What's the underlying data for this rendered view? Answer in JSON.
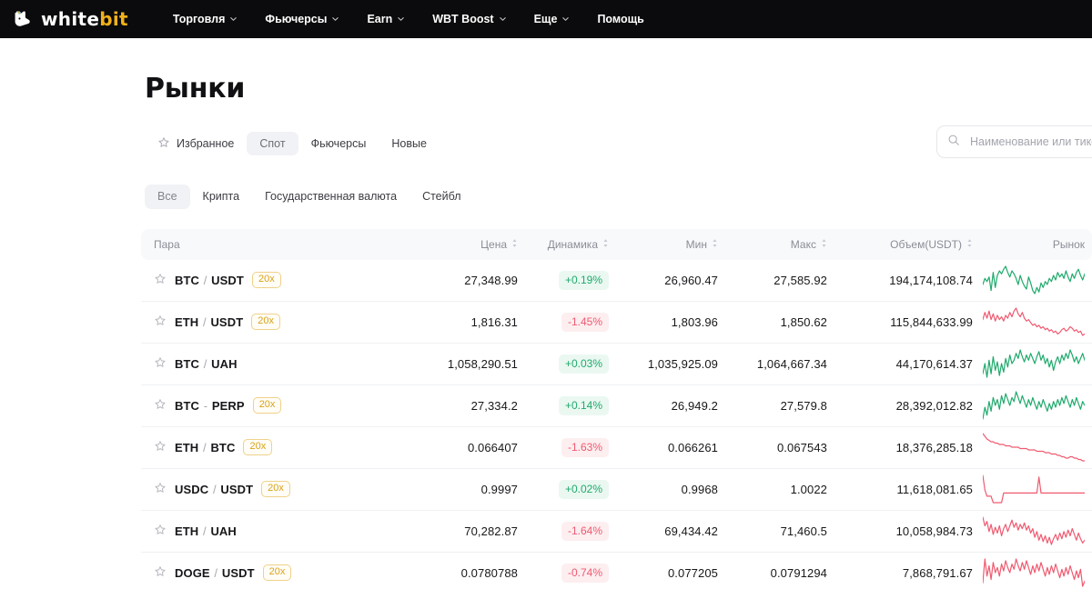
{
  "brand": {
    "name_white": "white",
    "name_accent": "bit",
    "logo_icon": "whitebit-rabbit-logo-icon"
  },
  "nav": {
    "items": [
      {
        "label": "Торговля",
        "has_dropdown": true
      },
      {
        "label": "Фьючерсы",
        "has_dropdown": true
      },
      {
        "label": "Earn",
        "has_dropdown": true
      },
      {
        "label": "WBT Boost",
        "has_dropdown": true
      },
      {
        "label": "Еще",
        "has_dropdown": true
      },
      {
        "label": "Помощь",
        "has_dropdown": false
      }
    ]
  },
  "page": {
    "title": "Рынки"
  },
  "tabs": [
    {
      "label": "Избранное",
      "icon": "star-outline-icon",
      "active": false
    },
    {
      "label": "Спот",
      "icon": null,
      "active": true
    },
    {
      "label": "Фьючерсы",
      "icon": null,
      "active": false
    },
    {
      "label": "Новые",
      "icon": null,
      "active": false
    }
  ],
  "search": {
    "placeholder": "Наименование или тикер",
    "value": "",
    "icon": "search-icon"
  },
  "filters": [
    {
      "label": "Все",
      "active": true
    },
    {
      "label": "Крипта",
      "active": false
    },
    {
      "label": "Государственная валюта",
      "active": false
    },
    {
      "label": "Стейбл",
      "active": false
    }
  ],
  "table": {
    "columns": [
      {
        "key": "pair",
        "label": "Пара",
        "sortable": false
      },
      {
        "key": "price",
        "label": "Цена",
        "sortable": true
      },
      {
        "key": "change",
        "label": "Динамика",
        "sortable": true
      },
      {
        "key": "min",
        "label": "Мин",
        "sortable": true
      },
      {
        "key": "max",
        "label": "Макс",
        "sortable": true
      },
      {
        "key": "volume",
        "label": "Объем(USDT)",
        "sortable": true
      },
      {
        "key": "market",
        "label": "Рынок",
        "sortable": false
      }
    ],
    "rows": [
      {
        "base": "BTC",
        "separator": "/",
        "quote": "USDT",
        "leverage": "20x",
        "price": "27,348.99",
        "change": "+0.19%",
        "direction": "up",
        "min": "26,960.47",
        "max": "27,585.92",
        "volume": "194,174,108.74",
        "spark_color": "up",
        "spark": [
          18,
          14,
          16,
          13,
          22,
          10,
          20,
          12,
          9,
          11,
          8,
          6,
          10,
          13,
          9,
          11,
          14,
          18,
          12,
          16,
          19,
          21,
          13,
          17,
          22,
          24,
          20,
          23,
          17,
          20,
          16,
          18,
          14,
          16,
          12,
          15,
          10,
          13,
          11,
          14,
          9,
          13,
          16,
          11,
          14,
          10,
          8,
          12,
          15,
          11
        ]
      },
      {
        "base": "ETH",
        "separator": "/",
        "quote": "USDT",
        "leverage": "20x",
        "price": "1,816.31",
        "change": "-1.45%",
        "direction": "down",
        "min": "1,803.96",
        "max": "1,850.62",
        "volume": "115,844,633.99",
        "spark_color": "down",
        "spark": [
          13,
          8,
          12,
          7,
          13,
          9,
          14,
          10,
          13,
          11,
          14,
          10,
          12,
          8,
          11,
          7,
          5,
          9,
          11,
          8,
          12,
          14,
          13,
          15,
          17,
          16,
          18,
          17,
          19,
          18,
          20,
          19,
          21,
          20,
          22,
          21,
          23,
          22,
          20,
          19,
          21,
          20,
          18,
          19,
          21,
          20,
          22,
          21,
          24,
          23
        ]
      },
      {
        "base": "BTC",
        "separator": "/",
        "quote": "UAH",
        "leverage": null,
        "price": "1,058,290.51",
        "change": "+0.03%",
        "direction": "up",
        "min": "1,035,925.09",
        "max": "1,064,667.34",
        "volume": "44,170,614.37",
        "spark_color": "up",
        "spark": [
          20,
          14,
          22,
          12,
          20,
          10,
          18,
          13,
          21,
          14,
          19,
          11,
          16,
          9,
          14,
          12,
          8,
          11,
          6,
          10,
          13,
          9,
          12,
          8,
          11,
          14,
          10,
          7,
          12,
          9,
          14,
          11,
          16,
          12,
          18,
          13,
          10,
          14,
          9,
          12,
          8,
          11,
          6,
          9,
          13,
          10,
          14,
          11,
          8,
          12
        ]
      },
      {
        "base": "BTC",
        "separator": "-",
        "quote": "PERP",
        "leverage": "20x",
        "price": "27,334.2",
        "change": "+0.14%",
        "direction": "up",
        "min": "26,949.2",
        "max": "27,579.8",
        "volume": "28,392,012.82",
        "spark_color": "up",
        "spark": [
          19,
          13,
          17,
          10,
          15,
          8,
          12,
          9,
          14,
          7,
          11,
          6,
          9,
          12,
          8,
          10,
          5,
          8,
          11,
          7,
          10,
          13,
          9,
          12,
          8,
          11,
          14,
          10,
          13,
          9,
          12,
          15,
          11,
          14,
          10,
          13,
          9,
          12,
          8,
          11,
          7,
          10,
          13,
          9,
          12,
          8,
          11,
          14,
          10,
          12
        ]
      },
      {
        "base": "ETH",
        "separator": "/",
        "quote": "BTC",
        "leverage": "20x",
        "price": "0.066407",
        "change": "-1.63%",
        "direction": "down",
        "min": "0.066261",
        "max": "0.067543",
        "volume": "18,376,285.18",
        "spark_color": "down",
        "spark": [
          4,
          6,
          8,
          9,
          10,
          10,
          11,
          11,
          12,
          12,
          12,
          13,
          13,
          13,
          14,
          14,
          14,
          14,
          15,
          15,
          15,
          15,
          16,
          16,
          16,
          16,
          17,
          17,
          17,
          17,
          18,
          18,
          18,
          19,
          19,
          19,
          20,
          20,
          21,
          21,
          22,
          22,
          21,
          21,
          22,
          22,
          23,
          23,
          24,
          24
        ]
      },
      {
        "base": "USDC",
        "separator": "/",
        "quote": "USDT",
        "leverage": "20x",
        "price": "0.9997",
        "change": "+0.02%",
        "direction": "up",
        "min": "0.9968",
        "max": "1.0022",
        "volume": "11,618,081.65",
        "spark_color": "down",
        "spark": [
          5,
          14,
          18,
          18,
          18,
          22,
          22,
          22,
          22,
          22,
          16,
          16,
          16,
          16,
          16,
          16,
          16,
          16,
          16,
          16,
          16,
          16,
          16,
          16,
          16,
          16,
          16,
          6,
          16,
          16,
          16,
          16,
          16,
          16,
          16,
          16,
          16,
          16,
          16,
          16,
          16,
          16,
          16,
          16,
          16,
          16,
          16,
          16,
          16,
          16
        ]
      },
      {
        "base": "ETH",
        "separator": "/",
        "quote": "UAH",
        "leverage": null,
        "price": "70,282.87",
        "change": "-1.64%",
        "direction": "down",
        "min": "69,434.42",
        "max": "71,460.5",
        "volume": "10,058,984.73",
        "spark_color": "down",
        "spark": [
          4,
          10,
          7,
          14,
          9,
          16,
          11,
          15,
          10,
          17,
          12,
          9,
          14,
          10,
          6,
          11,
          8,
          13,
          9,
          12,
          8,
          13,
          10,
          15,
          12,
          18,
          14,
          20,
          16,
          21,
          17,
          22,
          18,
          23,
          19,
          16,
          20,
          15,
          19,
          14,
          18,
          13,
          17,
          12,
          16,
          20,
          15,
          19,
          22,
          20
        ]
      },
      {
        "base": "DOGE",
        "separator": "/",
        "quote": "USDT",
        "leverage": "20x",
        "price": "0.0780788",
        "change": "-0.74%",
        "direction": "down",
        "min": "0.077205",
        "max": "0.0791294",
        "volume": "7,868,791.67",
        "spark_color": "down",
        "spark": [
          20,
          6,
          16,
          10,
          18,
          8,
          14,
          11,
          16,
          9,
          13,
          7,
          11,
          14,
          9,
          12,
          6,
          10,
          13,
          8,
          12,
          7,
          11,
          15,
          10,
          14,
          9,
          13,
          8,
          12,
          16,
          11,
          15,
          10,
          14,
          9,
          13,
          17,
          12,
          16,
          11,
          15,
          10,
          14,
          18,
          13,
          17,
          12,
          22,
          19
        ]
      }
    ]
  },
  "colors": {
    "nav_bg": "#0b0b0d",
    "brand_accent": "#f2b11a",
    "up": "#1faa6c",
    "up_bg": "#eaf8f1",
    "down": "#ef5a70",
    "down_bg": "#fdeef0",
    "leverage": "#d9a21a",
    "header_bg": "#f8f9fb",
    "chip_active_bg": "#f1f2f5"
  }
}
